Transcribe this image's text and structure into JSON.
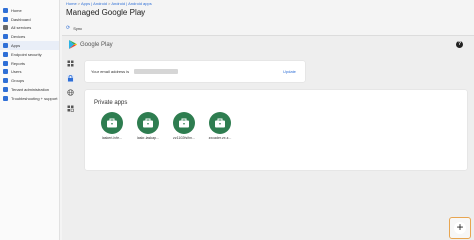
{
  "sidebar": {
    "items": [
      {
        "label": "Home",
        "color": "#2f6fd6"
      },
      {
        "label": "Dashboard",
        "color": "#2f6fd6"
      },
      {
        "label": "All services",
        "color": "#6a6a6a"
      },
      {
        "label": "Devices",
        "color": "#2f6fd6"
      },
      {
        "label": "Apps",
        "color": "#2f6fd6"
      },
      {
        "label": "Endpoint security",
        "color": "#2f6fd6"
      },
      {
        "label": "Reports",
        "color": "#2f6fd6"
      },
      {
        "label": "Users",
        "color": "#2f6fd6"
      },
      {
        "label": "Groups",
        "color": "#2f6fd6"
      },
      {
        "label": "Tenant administration",
        "color": "#2f6fd6"
      },
      {
        "label": "Troubleshooting + support",
        "color": "#2f6fd6"
      }
    ]
  },
  "breadcrumb": {
    "items": [
      "Home",
      "Apps | Android",
      "Android | Android apps"
    ],
    "separator": ">"
  },
  "header": {
    "title": "Managed Google Play",
    "pin_icon": "pin-icon"
  },
  "sync": {
    "label": "Sync",
    "icon": "sync-icon"
  },
  "google_play": {
    "title": "Google Play",
    "help": "?"
  },
  "rail": {
    "icons": [
      "apps-grid-icon",
      "lock-icon",
      "globe-icon",
      "grid-icon"
    ]
  },
  "email_card": {
    "label": "Your email address is",
    "update_link": "Update"
  },
  "private_apps": {
    "title": "Private apps",
    "apps": [
      {
        "label": "laskeri-lvfe..."
      },
      {
        "label": "laskr-laskap..."
      },
      {
        "label": "zz1102fsihn..."
      },
      {
        "label": "zxcader.zx.z..."
      }
    ],
    "icon_color": "#2e7d50"
  },
  "add_button": {
    "label": "+",
    "accent": "#e8a550"
  }
}
